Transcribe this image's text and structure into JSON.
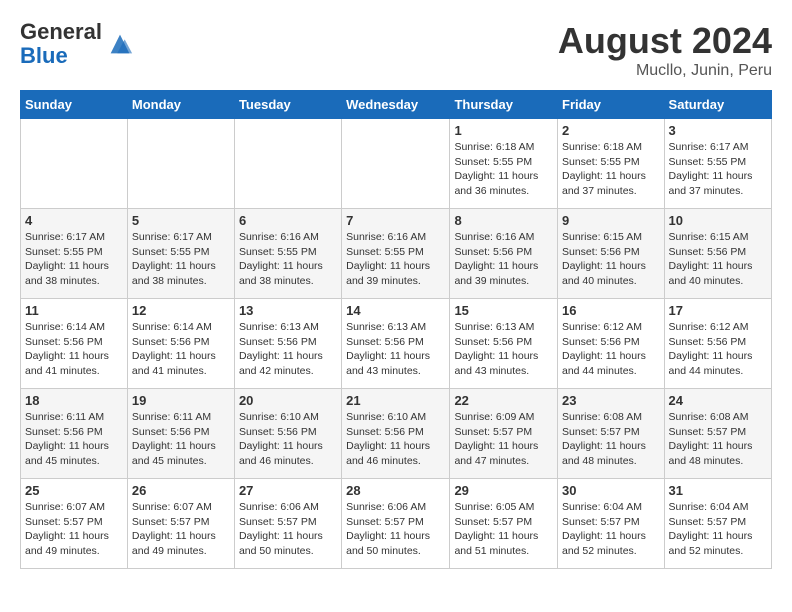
{
  "header": {
    "logo_general": "General",
    "logo_blue": "Blue",
    "month_year": "August 2024",
    "location": "Mucllo, Junin, Peru"
  },
  "days_of_week": [
    "Sunday",
    "Monday",
    "Tuesday",
    "Wednesday",
    "Thursday",
    "Friday",
    "Saturday"
  ],
  "weeks": [
    [
      {
        "day": "",
        "info": ""
      },
      {
        "day": "",
        "info": ""
      },
      {
        "day": "",
        "info": ""
      },
      {
        "day": "",
        "info": ""
      },
      {
        "day": "1",
        "info": "Sunrise: 6:18 AM\nSunset: 5:55 PM\nDaylight: 11 hours\nand 36 minutes."
      },
      {
        "day": "2",
        "info": "Sunrise: 6:18 AM\nSunset: 5:55 PM\nDaylight: 11 hours\nand 37 minutes."
      },
      {
        "day": "3",
        "info": "Sunrise: 6:17 AM\nSunset: 5:55 PM\nDaylight: 11 hours\nand 37 minutes."
      }
    ],
    [
      {
        "day": "4",
        "info": "Sunrise: 6:17 AM\nSunset: 5:55 PM\nDaylight: 11 hours\nand 38 minutes."
      },
      {
        "day": "5",
        "info": "Sunrise: 6:17 AM\nSunset: 5:55 PM\nDaylight: 11 hours\nand 38 minutes."
      },
      {
        "day": "6",
        "info": "Sunrise: 6:16 AM\nSunset: 5:55 PM\nDaylight: 11 hours\nand 38 minutes."
      },
      {
        "day": "7",
        "info": "Sunrise: 6:16 AM\nSunset: 5:55 PM\nDaylight: 11 hours\nand 39 minutes."
      },
      {
        "day": "8",
        "info": "Sunrise: 6:16 AM\nSunset: 5:56 PM\nDaylight: 11 hours\nand 39 minutes."
      },
      {
        "day": "9",
        "info": "Sunrise: 6:15 AM\nSunset: 5:56 PM\nDaylight: 11 hours\nand 40 minutes."
      },
      {
        "day": "10",
        "info": "Sunrise: 6:15 AM\nSunset: 5:56 PM\nDaylight: 11 hours\nand 40 minutes."
      }
    ],
    [
      {
        "day": "11",
        "info": "Sunrise: 6:14 AM\nSunset: 5:56 PM\nDaylight: 11 hours\nand 41 minutes."
      },
      {
        "day": "12",
        "info": "Sunrise: 6:14 AM\nSunset: 5:56 PM\nDaylight: 11 hours\nand 41 minutes."
      },
      {
        "day": "13",
        "info": "Sunrise: 6:13 AM\nSunset: 5:56 PM\nDaylight: 11 hours\nand 42 minutes."
      },
      {
        "day": "14",
        "info": "Sunrise: 6:13 AM\nSunset: 5:56 PM\nDaylight: 11 hours\nand 43 minutes."
      },
      {
        "day": "15",
        "info": "Sunrise: 6:13 AM\nSunset: 5:56 PM\nDaylight: 11 hours\nand 43 minutes."
      },
      {
        "day": "16",
        "info": "Sunrise: 6:12 AM\nSunset: 5:56 PM\nDaylight: 11 hours\nand 44 minutes."
      },
      {
        "day": "17",
        "info": "Sunrise: 6:12 AM\nSunset: 5:56 PM\nDaylight: 11 hours\nand 44 minutes."
      }
    ],
    [
      {
        "day": "18",
        "info": "Sunrise: 6:11 AM\nSunset: 5:56 PM\nDaylight: 11 hours\nand 45 minutes."
      },
      {
        "day": "19",
        "info": "Sunrise: 6:11 AM\nSunset: 5:56 PM\nDaylight: 11 hours\nand 45 minutes."
      },
      {
        "day": "20",
        "info": "Sunrise: 6:10 AM\nSunset: 5:56 PM\nDaylight: 11 hours\nand 46 minutes."
      },
      {
        "day": "21",
        "info": "Sunrise: 6:10 AM\nSunset: 5:56 PM\nDaylight: 11 hours\nand 46 minutes."
      },
      {
        "day": "22",
        "info": "Sunrise: 6:09 AM\nSunset: 5:57 PM\nDaylight: 11 hours\nand 47 minutes."
      },
      {
        "day": "23",
        "info": "Sunrise: 6:08 AM\nSunset: 5:57 PM\nDaylight: 11 hours\nand 48 minutes."
      },
      {
        "day": "24",
        "info": "Sunrise: 6:08 AM\nSunset: 5:57 PM\nDaylight: 11 hours\nand 48 minutes."
      }
    ],
    [
      {
        "day": "25",
        "info": "Sunrise: 6:07 AM\nSunset: 5:57 PM\nDaylight: 11 hours\nand 49 minutes."
      },
      {
        "day": "26",
        "info": "Sunrise: 6:07 AM\nSunset: 5:57 PM\nDaylight: 11 hours\nand 49 minutes."
      },
      {
        "day": "27",
        "info": "Sunrise: 6:06 AM\nSunset: 5:57 PM\nDaylight: 11 hours\nand 50 minutes."
      },
      {
        "day": "28",
        "info": "Sunrise: 6:06 AM\nSunset: 5:57 PM\nDaylight: 11 hours\nand 50 minutes."
      },
      {
        "day": "29",
        "info": "Sunrise: 6:05 AM\nSunset: 5:57 PM\nDaylight: 11 hours\nand 51 minutes."
      },
      {
        "day": "30",
        "info": "Sunrise: 6:04 AM\nSunset: 5:57 PM\nDaylight: 11 hours\nand 52 minutes."
      },
      {
        "day": "31",
        "info": "Sunrise: 6:04 AM\nSunset: 5:57 PM\nDaylight: 11 hours\nand 52 minutes."
      }
    ]
  ]
}
